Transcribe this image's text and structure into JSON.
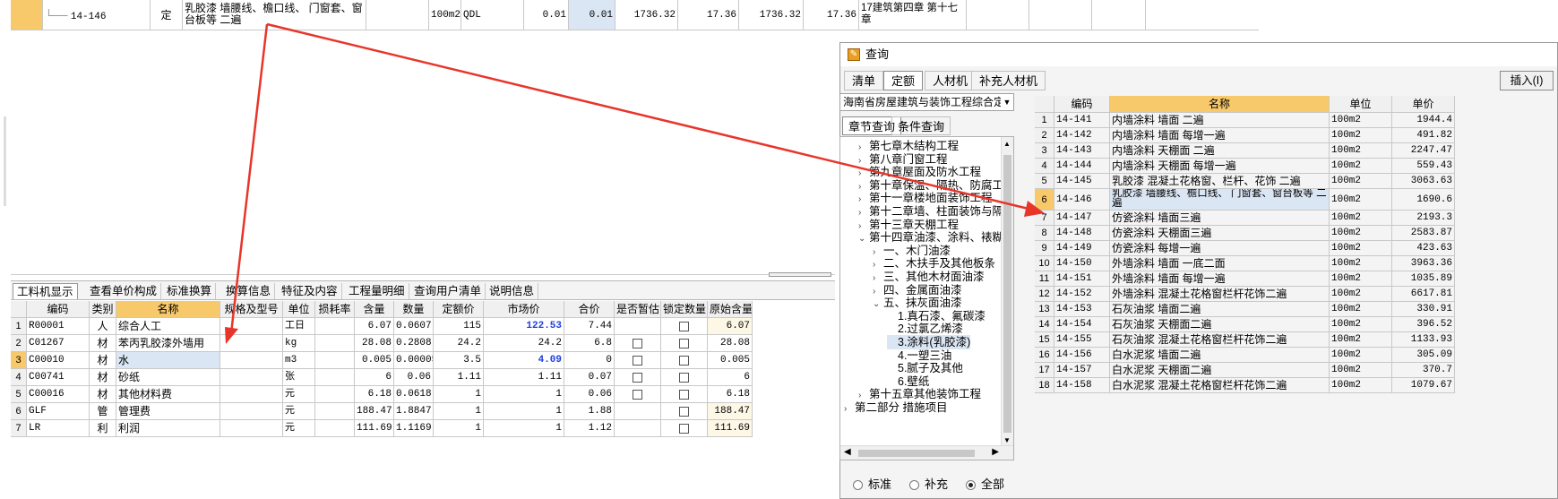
{
  "top_row": {
    "code": "14-146",
    "type": "定",
    "name": "乳胶漆 墙腰线、檐口线、 门窗套、窗台板等 二遍",
    "unit": "100m2",
    "qty_expr": "QDL",
    "qty1": "0.01",
    "qty2": "0.01",
    "price1": "1736.32",
    "total1": "17.36",
    "price2": "1736.32",
    "total2": "17.36",
    "note": "17建筑第四章 第十七章"
  },
  "bottom_tabs": [
    "工料机显示",
    "查看单价构成",
    "标准换算",
    "换算信息",
    "特征及内容",
    "工程量明细",
    "查询用户清单",
    "说明信息"
  ],
  "grid1": {
    "headers": [
      "编码",
      "类别",
      "名称",
      "规格及型号",
      "单位",
      "损耗率",
      "含量",
      "数量",
      "定额价",
      "市场价",
      "合价",
      "是否暂估",
      "锁定数量",
      "原始含量"
    ],
    "rows": [
      {
        "no": "1",
        "code": "R00001",
        "cat": "人",
        "name": "综合人工",
        "spec": "",
        "unit": "工日",
        "loss": "",
        "content": "6.07",
        "qty": "0.0607",
        "base": "115",
        "market": "122.53",
        "total": "7.44",
        "est": false,
        "lock": true,
        "orig": "6.07"
      },
      {
        "no": "2",
        "code": "C01267",
        "cat": "材",
        "name": "苯丙乳胶漆外墙用",
        "spec": "",
        "unit": "kg",
        "loss": "",
        "content": "28.08",
        "qty": "0.2808",
        "base": "24.2",
        "market": "24.2",
        "total": "6.8",
        "est": true,
        "lock": true,
        "orig": "28.08"
      },
      {
        "no": "3",
        "code": "C00010",
        "cat": "材",
        "name": "水",
        "spec": "",
        "unit": "m3",
        "loss": "",
        "content": "0.005",
        "qty": "0.00005",
        "base": "3.5",
        "market": "4.09",
        "total": "0",
        "est": true,
        "lock": true,
        "orig": "0.005"
      },
      {
        "no": "4",
        "code": "C00741",
        "cat": "材",
        "name": "砂纸",
        "spec": "",
        "unit": "张",
        "loss": "",
        "content": "6",
        "qty": "0.06",
        "base": "1.11",
        "market": "1.11",
        "total": "0.07",
        "est": true,
        "lock": true,
        "orig": "6"
      },
      {
        "no": "5",
        "code": "C00016",
        "cat": "材",
        "name": "其他材料费",
        "spec": "",
        "unit": "元",
        "loss": "",
        "content": "6.18",
        "qty": "0.0618",
        "base": "1",
        "market": "1",
        "total": "0.06",
        "est": true,
        "lock": true,
        "orig": "6.18"
      },
      {
        "no": "6",
        "code": "GLF",
        "cat": "管",
        "name": "管理费",
        "spec": "",
        "unit": "元",
        "loss": "",
        "content": "188.47",
        "qty": "1.8847",
        "base": "1",
        "market": "1",
        "total": "1.88",
        "est": false,
        "lock": true,
        "orig": "188.47"
      },
      {
        "no": "7",
        "code": "LR",
        "cat": "利",
        "name": "利润",
        "spec": "",
        "unit": "元",
        "loss": "",
        "content": "111.69",
        "qty": "1.1169",
        "base": "1",
        "market": "1",
        "total": "1.12",
        "est": false,
        "lock": true,
        "orig": "111.69"
      }
    ]
  },
  "dialog": {
    "title": "查询",
    "tabs": [
      "清单",
      "定额",
      "人材机",
      "补充人材机"
    ],
    "insert_label": "插入(I)",
    "library": "海南省房屋建筑与装饰工程综合定额",
    "subtabs": [
      "章节查询",
      "条件查询"
    ],
    "tree": [
      {
        "label": "第七章木结构工程",
        "indent": 1,
        "arrow": ">"
      },
      {
        "label": "第八章门窗工程",
        "indent": 1,
        "arrow": ">"
      },
      {
        "label": "第九章屋面及防水工程",
        "indent": 1,
        "arrow": ">"
      },
      {
        "label": "第十章保温、隔热、防腐工",
        "indent": 1,
        "arrow": ">"
      },
      {
        "label": "第十一章楼地面装饰工程",
        "indent": 1,
        "arrow": ">"
      },
      {
        "label": "第十二章墙、柱面装饰与隔",
        "indent": 1,
        "arrow": ">"
      },
      {
        "label": "第十三章天棚工程",
        "indent": 1,
        "arrow": ">"
      },
      {
        "label": "第十四章油漆、涂料、裱糊",
        "indent": 1,
        "arrow": "v"
      },
      {
        "label": "一、木门油漆",
        "indent": 2,
        "arrow": ">"
      },
      {
        "label": "二、木扶手及其他板条",
        "indent": 2,
        "arrow": ">"
      },
      {
        "label": "三、其他木材面油漆",
        "indent": 2,
        "arrow": ">"
      },
      {
        "label": "四、金属面油漆",
        "indent": 2,
        "arrow": ">"
      },
      {
        "label": "五、抹灰面油漆",
        "indent": 2,
        "arrow": "v"
      },
      {
        "label": "1.真石漆、氟碳漆",
        "indent": 3,
        "arrow": ""
      },
      {
        "label": "2.过氯乙烯漆",
        "indent": 3,
        "arrow": ""
      },
      {
        "label": "3.涂料(乳胶漆)",
        "indent": 3,
        "arrow": "",
        "selected": true
      },
      {
        "label": "4.一塑三油",
        "indent": 3,
        "arrow": ""
      },
      {
        "label": "5.腻子及其他",
        "indent": 3,
        "arrow": ""
      },
      {
        "label": "6.壁纸",
        "indent": 3,
        "arrow": ""
      },
      {
        "label": "第十五章其他装饰工程",
        "indent": 1,
        "arrow": ">"
      },
      {
        "label": "第二部分 措施项目",
        "indent": 0,
        "arrow": ">"
      }
    ],
    "radios": [
      "标准",
      "补充",
      "全部"
    ],
    "radio_selected": "全部",
    "grid": {
      "headers": [
        "编码",
        "名称",
        "单位",
        "单价"
      ],
      "rows": [
        {
          "no": "1",
          "code": "14-141",
          "name": "内墙涂料 墙面 二遍",
          "unit": "100m2",
          "price": "1944.4"
        },
        {
          "no": "2",
          "code": "14-142",
          "name": "内墙涂料 墙面 每增一遍",
          "unit": "100m2",
          "price": "491.82"
        },
        {
          "no": "3",
          "code": "14-143",
          "name": "内墙涂料 天棚面 二遍",
          "unit": "100m2",
          "price": "2247.47"
        },
        {
          "no": "4",
          "code": "14-144",
          "name": "内墙涂料 天棚面 每增一遍",
          "unit": "100m2",
          "price": "559.43"
        },
        {
          "no": "5",
          "code": "14-145",
          "name": "乳胶漆 混凝土花格窗、栏杆、花饰 二遍",
          "unit": "100m2",
          "price": "3063.63"
        },
        {
          "no": "6",
          "code": "14-146",
          "name": "乳胶漆 墙腰线、檐口线、 门窗套、窗台板等 二遍",
          "unit": "100m2",
          "price": "1690.6",
          "current": true
        },
        {
          "no": "7",
          "code": "14-147",
          "name": "仿瓷涂料 墙面三遍",
          "unit": "100m2",
          "price": "2193.3"
        },
        {
          "no": "8",
          "code": "14-148",
          "name": "仿瓷涂料 天棚面三遍",
          "unit": "100m2",
          "price": "2583.87"
        },
        {
          "no": "9",
          "code": "14-149",
          "name": "仿瓷涂料 每增一遍",
          "unit": "100m2",
          "price": "423.63"
        },
        {
          "no": "10",
          "code": "14-150",
          "name": "外墙涂料 墙面 一底二面",
          "unit": "100m2",
          "price": "3963.36"
        },
        {
          "no": "11",
          "code": "14-151",
          "name": "外墙涂料 墙面 每增一遍",
          "unit": "100m2",
          "price": "1035.89"
        },
        {
          "no": "12",
          "code": "14-152",
          "name": "外墙涂料 混凝土花格窗栏杆花饰二遍",
          "unit": "100m2",
          "price": "6617.81"
        },
        {
          "no": "13",
          "code": "14-153",
          "name": "石灰油浆 墙面二遍",
          "unit": "100m2",
          "price": "330.91"
        },
        {
          "no": "14",
          "code": "14-154",
          "name": "石灰油浆 天棚面二遍",
          "unit": "100m2",
          "price": "396.52"
        },
        {
          "no": "15",
          "code": "14-155",
          "name": "石灰油浆 混凝土花格窗栏杆花饰二遍",
          "unit": "100m2",
          "price": "1133.93"
        },
        {
          "no": "16",
          "code": "14-156",
          "name": "白水泥浆 墙面二遍",
          "unit": "100m2",
          "price": "305.09"
        },
        {
          "no": "17",
          "code": "14-157",
          "name": "白水泥浆 天棚面二遍",
          "unit": "100m2",
          "price": "370.7"
        },
        {
          "no": "18",
          "code": "14-158",
          "name": "白水泥浆 混凝土花格窗栏杆花饰二遍",
          "unit": "100m2",
          "price": "1079.67"
        }
      ]
    }
  },
  "colors": {
    "arrow": "#e8352a",
    "highlight": "#f7c96a",
    "blue_text": "#1f3fe0",
    "selection": "#dbe6f5"
  }
}
